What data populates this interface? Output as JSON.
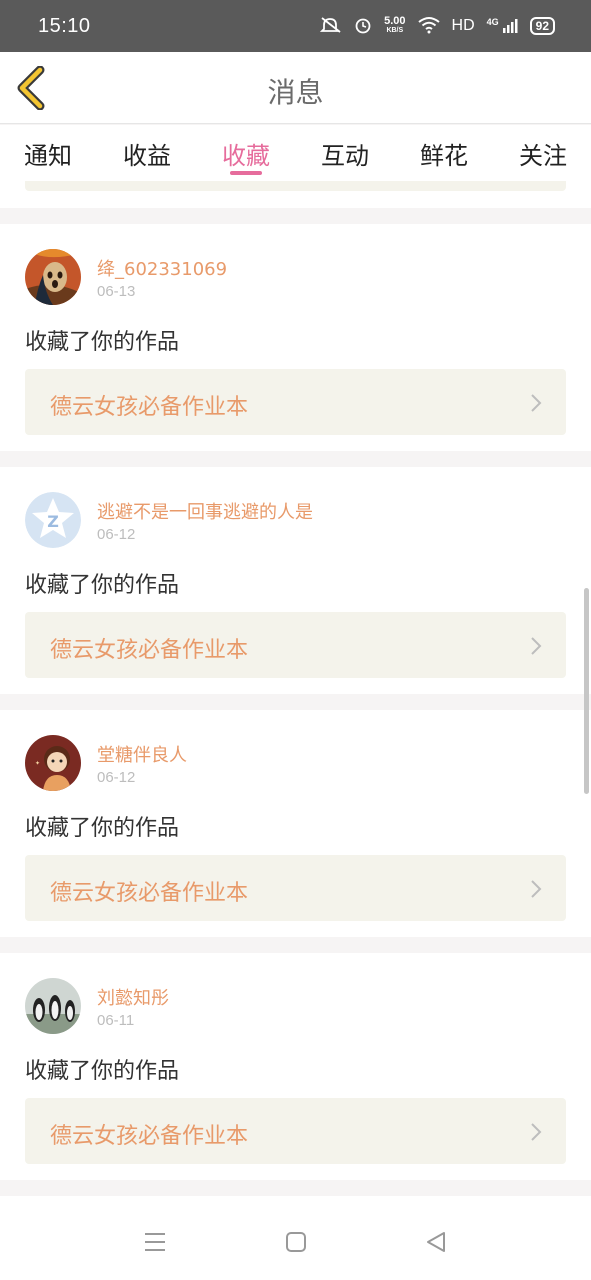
{
  "status_bar": {
    "time": "15:10",
    "net_speed_value": "5.00",
    "net_speed_unit": "KB/S",
    "hd": "HD",
    "network": "4G",
    "battery": "92"
  },
  "header": {
    "title": "消息",
    "back_icon": "back-chevron-icon"
  },
  "tabs": [
    {
      "label": "通知",
      "active": false
    },
    {
      "label": "收益",
      "active": false
    },
    {
      "label": "收藏",
      "active": true
    },
    {
      "label": "互动",
      "active": false
    },
    {
      "label": "鲜花",
      "active": false
    },
    {
      "label": "关注",
      "active": false
    }
  ],
  "notifications": [
    {
      "username": "绛_602331069",
      "date": "06-13",
      "action": "收藏了你的作品",
      "work_title": "德云女孩必备作业本"
    },
    {
      "username": "逃避不是一回事逃避的人是",
      "date": "06-12",
      "action": "收藏了你的作品",
      "work_title": "德云女孩必备作业本"
    },
    {
      "username": "堂糖伴良人",
      "date": "06-12",
      "action": "收藏了你的作品",
      "work_title": "德云女孩必备作业本"
    },
    {
      "username": "刘懿知彤",
      "date": "06-11",
      "action": "收藏了你的作品",
      "work_title": "德云女孩必备作业本"
    }
  ],
  "colors": {
    "accent": "#e66c9c",
    "username": "#e89a6a",
    "work_box_bg": "#f4f3eb"
  },
  "nav_bar": {
    "icons": [
      "menu-icon",
      "home-square-icon",
      "back-triangle-icon"
    ]
  }
}
